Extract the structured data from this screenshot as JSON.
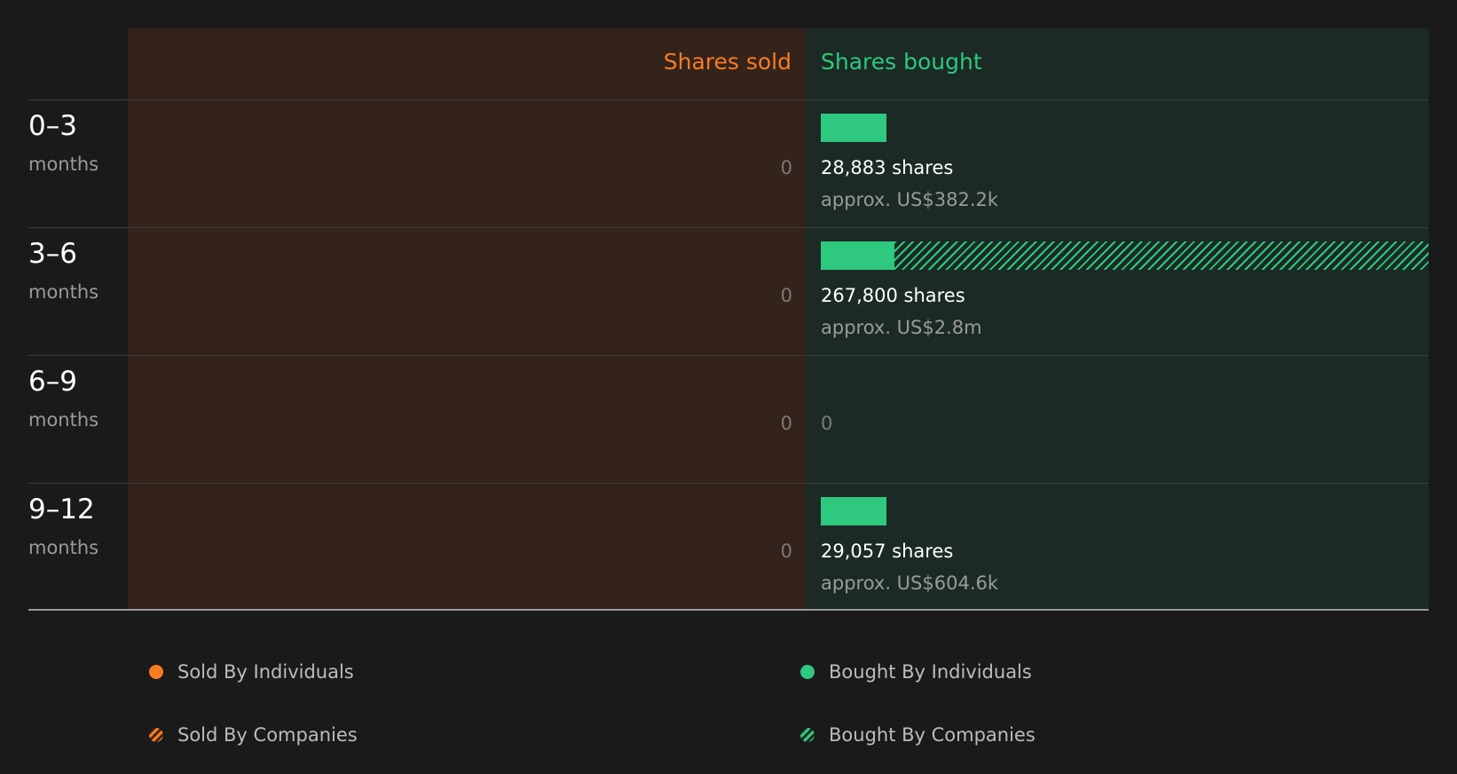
{
  "colors": {
    "sold": "#f97b22",
    "bought": "#2ec87e",
    "sold_panel": "#33231b",
    "bought_panel": "#1b2a24"
  },
  "chart_data": {
    "type": "bar",
    "headers": {
      "sold": "Shares sold",
      "bought": "Shares bought"
    },
    "categories": [
      {
        "range": "0–3",
        "unit": "months"
      },
      {
        "range": "3–6",
        "unit": "months"
      },
      {
        "range": "6–9",
        "unit": "months"
      },
      {
        "range": "9–12",
        "unit": "months"
      }
    ],
    "rows": [
      {
        "sold_label": "0",
        "sold_by_individuals": 0,
        "sold_by_companies": 0,
        "bought_by_individuals": 28883,
        "bought_by_companies": 0,
        "bought_label": "28,883 shares",
        "bought_value_label": "approx. US$382.2k"
      },
      {
        "sold_label": "0",
        "sold_by_individuals": 0,
        "sold_by_companies": 0,
        "bought_by_individuals": 32500,
        "bought_by_companies": 235300,
        "bought_label": "267,800 shares",
        "bought_value_label": "approx. US$2.8m"
      },
      {
        "sold_label": "0",
        "sold_by_individuals": 0,
        "sold_by_companies": 0,
        "bought_by_individuals": 0,
        "bought_by_companies": 0,
        "bought_label": "0",
        "bought_value_label": ""
      },
      {
        "sold_label": "0",
        "sold_by_individuals": 0,
        "sold_by_companies": 0,
        "bought_by_individuals": 29057,
        "bought_by_companies": 0,
        "bought_label": "29,057 shares",
        "bought_value_label": "approx. US$604.6k"
      }
    ],
    "bought_max": 267800,
    "legend": {
      "sold_individuals": "Sold By Individuals",
      "sold_companies": "Sold By Companies",
      "bought_individuals": "Bought By Individuals",
      "bought_companies": "Bought By Companies"
    }
  }
}
